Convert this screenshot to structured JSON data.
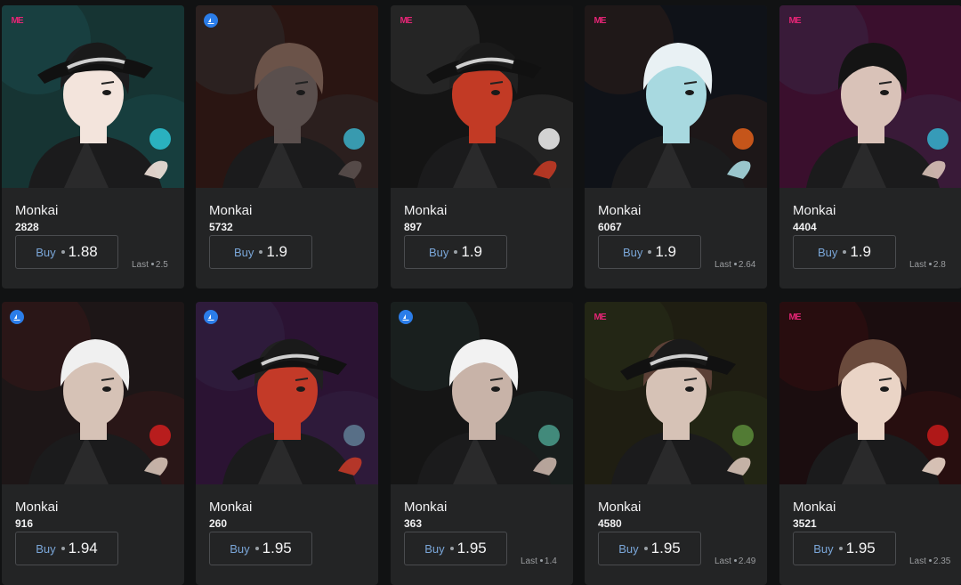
{
  "collection": "Monkai",
  "buy_label": "Buy",
  "last_label": "Last",
  "cards": [
    {
      "name": "Monkai",
      "token": "2828",
      "price": "1.88",
      "last": "2.5",
      "marketplace": "magic-eden",
      "bg": "#163433",
      "hair": "#1c1c1e",
      "skin": "#f3e4dc",
      "accent": "#2ec6d6",
      "hat": true
    },
    {
      "name": "Monkai",
      "token": "5732",
      "price": "1.9",
      "last": "",
      "marketplace": "opensea",
      "bg": "#2a1512",
      "hair": "#6b5349",
      "skin": "#5a4f4d",
      "accent": "#3bb0c9",
      "hat": false
    },
    {
      "name": "Monkai",
      "token": "897",
      "price": "1.9",
      "last": "",
      "marketplace": "magic-eden",
      "bg": "#141414",
      "hair": "#202020",
      "skin": "#c23a25",
      "accent": "#f2f2f2",
      "hat": true
    },
    {
      "name": "Monkai",
      "token": "6067",
      "price": "1.9",
      "last": "2.64",
      "marketplace": "magic-eden",
      "bg": "#0f1218",
      "hair": "#e9f1f4",
      "skin": "#a8d9e0",
      "accent": "#e3601b",
      "hat": false
    },
    {
      "name": "Monkai",
      "token": "4404",
      "price": "1.9",
      "last": "2.8",
      "marketplace": "magic-eden",
      "bg": "#3a0f2d",
      "hair": "#141414",
      "skin": "#d9c2b8",
      "accent": "#36b3cf",
      "hat": false
    },
    {
      "name": "Monkai",
      "token": "916",
      "price": "1.94",
      "last": "",
      "marketplace": "opensea",
      "bg": "#1d1617",
      "hair": "#f0f0f0",
      "skin": "#d6c2b6",
      "accent": "#d11e1e",
      "hat": false
    },
    {
      "name": "Monkai",
      "token": "260",
      "price": "1.95",
      "last": "",
      "marketplace": "opensea",
      "bg": "#2b1333",
      "hair": "#202020",
      "skin": "#c33a28",
      "accent": "#5f7f95",
      "hat": true
    },
    {
      "name": "Monkai",
      "token": "363",
      "price": "1.95",
      "last": "1.4",
      "marketplace": "opensea",
      "bg": "#151515",
      "hair": "#f2f2f2",
      "skin": "#c8b3a8",
      "accent": "#4a9e8c",
      "hat": false
    },
    {
      "name": "Monkai",
      "token": "4580",
      "price": "1.95",
      "last": "2.49",
      "marketplace": "magic-eden",
      "bg": "#1f1e12",
      "hair": "#5b4036",
      "skin": "#d6c2b6",
      "accent": "#5a8b3a",
      "hat": true
    },
    {
      "name": "Monkai",
      "token": "3521",
      "price": "1.95",
      "last": "2.35",
      "marketplace": "magic-eden",
      "bg": "#1b0d0f",
      "hair": "#6a4a3c",
      "skin": "#ead4c6",
      "accent": "#c81a1a",
      "hat": false
    }
  ]
}
